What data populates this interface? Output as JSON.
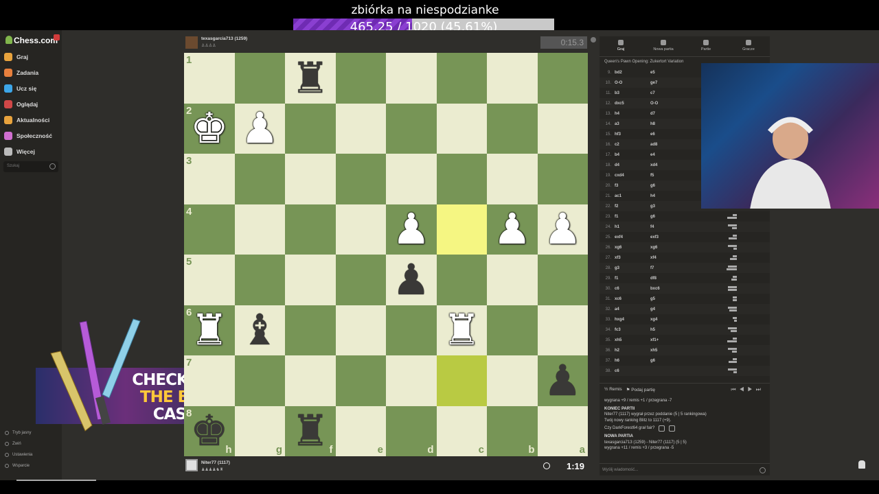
{
  "stream": {
    "donation_title": "zbiórka na niespodzianke",
    "donation_amount": "465.25 / 1020 (45.61%)",
    "donation_progress_pct": 45.61
  },
  "sidebar": {
    "logo": "Chess.com",
    "items": [
      {
        "label": "Graj",
        "icon": "play-icon",
        "color": "#e8a33d"
      },
      {
        "label": "Zadania",
        "icon": "puzzle-icon",
        "color": "#e8803d"
      },
      {
        "label": "Ucz się",
        "icon": "learn-icon",
        "color": "#3da6e8"
      },
      {
        "label": "Oglądaj",
        "icon": "watch-icon",
        "color": "#d04747"
      },
      {
        "label": "Aktualności",
        "icon": "news-icon",
        "color": "#e8a33d"
      },
      {
        "label": "Społeczność",
        "icon": "community-icon",
        "color": "#d06fd0"
      },
      {
        "label": "Więcej",
        "icon": "more-icon",
        "color": "#bbbbbb"
      }
    ],
    "search_placeholder": "Szukaj",
    "footer": [
      "Tryb jasny",
      "Zwiń",
      "Ustawienia",
      "Wsparcie"
    ]
  },
  "ad": {
    "line1": "CHECK OUT",
    "line2": "THE BEST",
    "line3": "CASES"
  },
  "opponent": {
    "name": "texasgarcia713",
    "rating": "(1259)",
    "clock": "0:15.3"
  },
  "me": {
    "name": "Niter77",
    "rating": "(1117)",
    "clock": "1:19"
  },
  "board": {
    "ranks": [
      "1",
      "2",
      "3",
      "4",
      "5",
      "6",
      "7",
      "8"
    ],
    "files": [
      "h",
      "g",
      "f",
      "e",
      "d",
      "c",
      "b",
      "a"
    ],
    "highlight": [
      "3-5",
      "6-5"
    ],
    "pieces": [
      {
        "r": 0,
        "c": 2,
        "p": "♜",
        "side": "b"
      },
      {
        "r": 1,
        "c": 0,
        "p": "♚",
        "side": "w"
      },
      {
        "r": 1,
        "c": 1,
        "p": "♟",
        "side": "w"
      },
      {
        "r": 3,
        "c": 4,
        "p": "♟",
        "side": "w"
      },
      {
        "r": 3,
        "c": 6,
        "p": "♟",
        "side": "w"
      },
      {
        "r": 3,
        "c": 7,
        "p": "♟",
        "side": "w"
      },
      {
        "r": 4,
        "c": 4,
        "p": "♟",
        "side": "b"
      },
      {
        "r": 5,
        "c": 0,
        "p": "♜",
        "side": "w"
      },
      {
        "r": 5,
        "c": 1,
        "p": "♝",
        "side": "b"
      },
      {
        "r": 5,
        "c": 5,
        "p": "♜",
        "side": "w"
      },
      {
        "r": 6,
        "c": 7,
        "p": "♟",
        "side": "b"
      },
      {
        "r": 7,
        "c": 0,
        "p": "♚",
        "side": "b"
      },
      {
        "r": 7,
        "c": 2,
        "p": "♜",
        "side": "b"
      }
    ]
  },
  "panel": {
    "tabs": [
      "Graj",
      "Nowa partia",
      "Partie",
      "Gracze"
    ],
    "opening": "Queen's Pawn Opening: Zukertort Variation",
    "moves": [
      {
        "n": "9.",
        "w": "bd2",
        "b": "e5"
      },
      {
        "n": "10.",
        "w": "O-O",
        "b": "ge7"
      },
      {
        "n": "11.",
        "w": "b3",
        "b": "c7"
      },
      {
        "n": "12.",
        "w": "dxc5",
        "b": "O-O"
      },
      {
        "n": "13.",
        "w": "h4",
        "b": "d7"
      },
      {
        "n": "14.",
        "w": "a3",
        "b": "h8"
      },
      {
        "n": "15.",
        "w": "hf3",
        "b": "e6"
      },
      {
        "n": "16.",
        "w": "c2",
        "b": "ad8"
      },
      {
        "n": "17.",
        "w": "b4",
        "b": "e4"
      },
      {
        "n": "18.",
        "w": "d4",
        "b": "xd4"
      },
      {
        "n": "19.",
        "w": "cxd4",
        "b": "f5"
      },
      {
        "n": "20.",
        "w": "f3",
        "b": "g6"
      },
      {
        "n": "21.",
        "w": "ac1",
        "b": "h4"
      },
      {
        "n": "22.",
        "w": "f2",
        "b": "g3"
      },
      {
        "n": "23.",
        "w": "f1",
        "b": "g6"
      },
      {
        "n": "24.",
        "w": "h1",
        "b": "f4"
      },
      {
        "n": "25.",
        "w": "exf4",
        "b": "exf3"
      },
      {
        "n": "26.",
        "w": "xg6",
        "b": "xg6"
      },
      {
        "n": "27.",
        "w": "xf3",
        "b": "xf4"
      },
      {
        "n": "28.",
        "w": "g3",
        "b": "f7"
      },
      {
        "n": "29.",
        "w": "f1",
        "b": "df8"
      },
      {
        "n": "30.",
        "w": "c6",
        "b": "bxc6"
      },
      {
        "n": "31.",
        "w": "xc6",
        "b": "g5"
      },
      {
        "n": "32.",
        "w": "a4",
        "b": "g4"
      },
      {
        "n": "33.",
        "w": "hxg4",
        "b": "xg4"
      },
      {
        "n": "34.",
        "w": "fc3",
        "b": "h5"
      },
      {
        "n": "35.",
        "w": "xh5",
        "b": "xf1+"
      },
      {
        "n": "36.",
        "w": "h2",
        "b": "xh5"
      },
      {
        "n": "37.",
        "w": "h6",
        "b": "g6"
      },
      {
        "n": "38.",
        "w": "c6",
        "b": ""
      }
    ],
    "draw_label": "Remis",
    "resign_label": "Podaj partię",
    "chat": {
      "line0": "wygrana +9 / remis +1 / przegrana -7",
      "end_title": "KONIEC PARTII",
      "end_line1": "Niter77 (1117) wygrał przez poddanie (5 | 5 rankingowa)",
      "end_line2": "Twój nowy ranking Blitz to 1117 (+9).",
      "question": "Czy DarkForest64 grał fair?",
      "new_title": "NOWA PARTIA",
      "new_line1": "texasgarcia713 (1259) - Niter77 (1117) (5 | 5)",
      "new_line2": "wygrana +11 / remis +3 / przegrana -5"
    },
    "chat_placeholder": "Wyślij wiadomość..."
  }
}
